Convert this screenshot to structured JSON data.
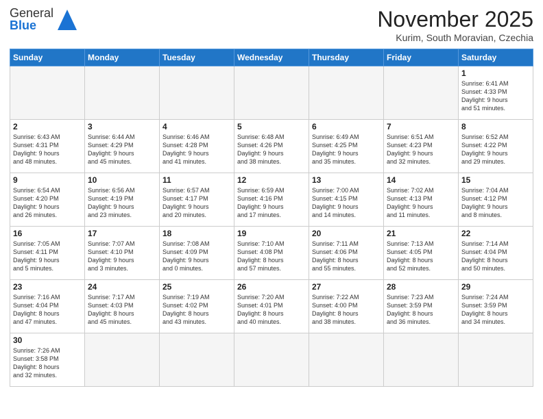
{
  "header": {
    "logo_general": "General",
    "logo_blue": "Blue",
    "title": "November 2025",
    "subtitle": "Kurim, South Moravian, Czechia"
  },
  "days_of_week": [
    "Sunday",
    "Monday",
    "Tuesday",
    "Wednesday",
    "Thursday",
    "Friday",
    "Saturday"
  ],
  "weeks": [
    [
      {
        "day": "",
        "info": "",
        "empty": true
      },
      {
        "day": "",
        "info": "",
        "empty": true
      },
      {
        "day": "",
        "info": "",
        "empty": true
      },
      {
        "day": "",
        "info": "",
        "empty": true
      },
      {
        "day": "",
        "info": "",
        "empty": true
      },
      {
        "day": "",
        "info": "",
        "empty": true
      },
      {
        "day": "1",
        "info": "Sunrise: 6:41 AM\nSunset: 4:33 PM\nDaylight: 9 hours\nand 51 minutes."
      }
    ],
    [
      {
        "day": "2",
        "info": "Sunrise: 6:43 AM\nSunset: 4:31 PM\nDaylight: 9 hours\nand 48 minutes."
      },
      {
        "day": "3",
        "info": "Sunrise: 6:44 AM\nSunset: 4:29 PM\nDaylight: 9 hours\nand 45 minutes."
      },
      {
        "day": "4",
        "info": "Sunrise: 6:46 AM\nSunset: 4:28 PM\nDaylight: 9 hours\nand 41 minutes."
      },
      {
        "day": "5",
        "info": "Sunrise: 6:48 AM\nSunset: 4:26 PM\nDaylight: 9 hours\nand 38 minutes."
      },
      {
        "day": "6",
        "info": "Sunrise: 6:49 AM\nSunset: 4:25 PM\nDaylight: 9 hours\nand 35 minutes."
      },
      {
        "day": "7",
        "info": "Sunrise: 6:51 AM\nSunset: 4:23 PM\nDaylight: 9 hours\nand 32 minutes."
      },
      {
        "day": "8",
        "info": "Sunrise: 6:52 AM\nSunset: 4:22 PM\nDaylight: 9 hours\nand 29 minutes."
      }
    ],
    [
      {
        "day": "9",
        "info": "Sunrise: 6:54 AM\nSunset: 4:20 PM\nDaylight: 9 hours\nand 26 minutes."
      },
      {
        "day": "10",
        "info": "Sunrise: 6:56 AM\nSunset: 4:19 PM\nDaylight: 9 hours\nand 23 minutes."
      },
      {
        "day": "11",
        "info": "Sunrise: 6:57 AM\nSunset: 4:17 PM\nDaylight: 9 hours\nand 20 minutes."
      },
      {
        "day": "12",
        "info": "Sunrise: 6:59 AM\nSunset: 4:16 PM\nDaylight: 9 hours\nand 17 minutes."
      },
      {
        "day": "13",
        "info": "Sunrise: 7:00 AM\nSunset: 4:15 PM\nDaylight: 9 hours\nand 14 minutes."
      },
      {
        "day": "14",
        "info": "Sunrise: 7:02 AM\nSunset: 4:13 PM\nDaylight: 9 hours\nand 11 minutes."
      },
      {
        "day": "15",
        "info": "Sunrise: 7:04 AM\nSunset: 4:12 PM\nDaylight: 9 hours\nand 8 minutes."
      }
    ],
    [
      {
        "day": "16",
        "info": "Sunrise: 7:05 AM\nSunset: 4:11 PM\nDaylight: 9 hours\nand 5 minutes."
      },
      {
        "day": "17",
        "info": "Sunrise: 7:07 AM\nSunset: 4:10 PM\nDaylight: 9 hours\nand 3 minutes."
      },
      {
        "day": "18",
        "info": "Sunrise: 7:08 AM\nSunset: 4:09 PM\nDaylight: 9 hours\nand 0 minutes."
      },
      {
        "day": "19",
        "info": "Sunrise: 7:10 AM\nSunset: 4:08 PM\nDaylight: 8 hours\nand 57 minutes."
      },
      {
        "day": "20",
        "info": "Sunrise: 7:11 AM\nSunset: 4:06 PM\nDaylight: 8 hours\nand 55 minutes."
      },
      {
        "day": "21",
        "info": "Sunrise: 7:13 AM\nSunset: 4:05 PM\nDaylight: 8 hours\nand 52 minutes."
      },
      {
        "day": "22",
        "info": "Sunrise: 7:14 AM\nSunset: 4:04 PM\nDaylight: 8 hours\nand 50 minutes."
      }
    ],
    [
      {
        "day": "23",
        "info": "Sunrise: 7:16 AM\nSunset: 4:04 PM\nDaylight: 8 hours\nand 47 minutes."
      },
      {
        "day": "24",
        "info": "Sunrise: 7:17 AM\nSunset: 4:03 PM\nDaylight: 8 hours\nand 45 minutes."
      },
      {
        "day": "25",
        "info": "Sunrise: 7:19 AM\nSunset: 4:02 PM\nDaylight: 8 hours\nand 43 minutes."
      },
      {
        "day": "26",
        "info": "Sunrise: 7:20 AM\nSunset: 4:01 PM\nDaylight: 8 hours\nand 40 minutes."
      },
      {
        "day": "27",
        "info": "Sunrise: 7:22 AM\nSunset: 4:00 PM\nDaylight: 8 hours\nand 38 minutes."
      },
      {
        "day": "28",
        "info": "Sunrise: 7:23 AM\nSunset: 3:59 PM\nDaylight: 8 hours\nand 36 minutes."
      },
      {
        "day": "29",
        "info": "Sunrise: 7:24 AM\nSunset: 3:59 PM\nDaylight: 8 hours\nand 34 minutes."
      }
    ],
    [
      {
        "day": "30",
        "info": "Sunrise: 7:26 AM\nSunset: 3:58 PM\nDaylight: 8 hours\nand 32 minutes."
      },
      {
        "day": "",
        "info": "",
        "empty": true
      },
      {
        "day": "",
        "info": "",
        "empty": true
      },
      {
        "day": "",
        "info": "",
        "empty": true
      },
      {
        "day": "",
        "info": "",
        "empty": true
      },
      {
        "day": "",
        "info": "",
        "empty": true
      },
      {
        "day": "",
        "info": "",
        "empty": true
      }
    ]
  ]
}
